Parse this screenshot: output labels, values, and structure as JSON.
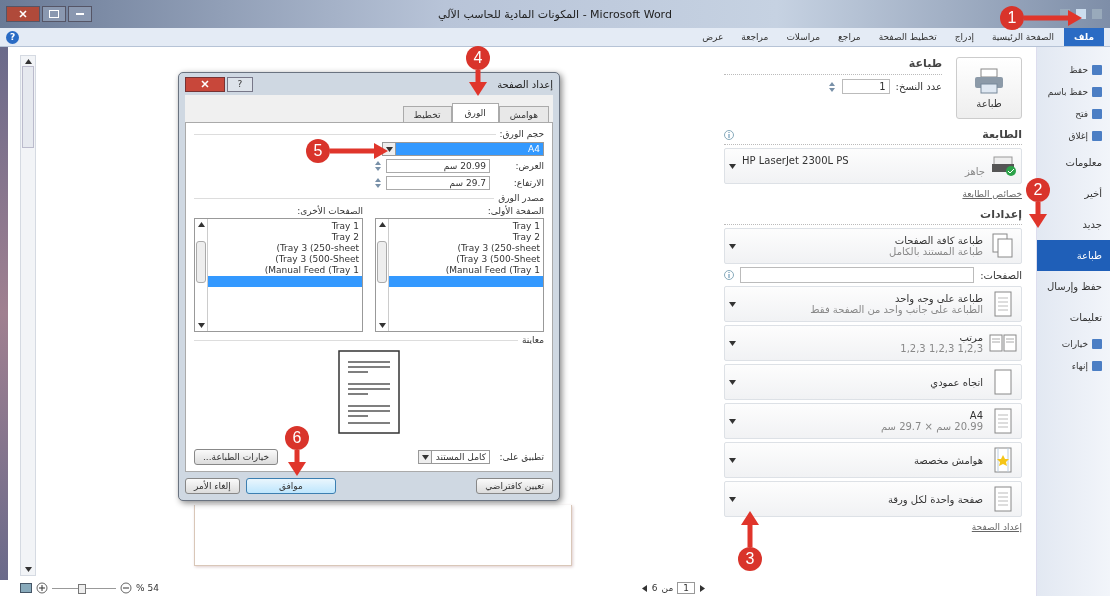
{
  "window": {
    "title": "المكونات المادية للحاسب الآلي - Microsoft Word"
  },
  "ribbon_tabs": [
    {
      "label": "ملف",
      "selected": true
    },
    {
      "label": "الصفحة الرئيسية",
      "selected": false
    },
    {
      "label": "إدراج",
      "selected": false
    },
    {
      "label": "تخطيط الصفحة",
      "selected": false
    },
    {
      "label": "مراجع",
      "selected": false
    },
    {
      "label": "مراسلات",
      "selected": false
    },
    {
      "label": "مراجعة",
      "selected": false
    },
    {
      "label": "عرض",
      "selected": false
    }
  ],
  "backstage_nav": [
    {
      "label": "حفظ",
      "kind": "command",
      "selected": false
    },
    {
      "label": "حفظ باسم",
      "kind": "command",
      "selected": false
    },
    {
      "label": "فتح",
      "kind": "command",
      "selected": false
    },
    {
      "label": "إغلاق",
      "kind": "command",
      "selected": false
    },
    {
      "label": "معلومات",
      "kind": "page",
      "selected": false
    },
    {
      "label": "أخير",
      "kind": "page",
      "selected": false
    },
    {
      "label": "جديد",
      "kind": "page",
      "selected": false
    },
    {
      "label": "طباعة",
      "kind": "page",
      "selected": true
    },
    {
      "label": "حفظ وإرسال",
      "kind": "page",
      "selected": false
    },
    {
      "label": "تعليمات",
      "kind": "page",
      "selected": false
    },
    {
      "label": "خيارات",
      "kind": "command",
      "selected": false
    },
    {
      "label": "إنهاء",
      "kind": "command",
      "selected": false
    }
  ],
  "print": {
    "heading": "طباعة",
    "copies_label": "عدد النسخ:",
    "copies": "1",
    "button": "طباعة",
    "printer_heading": "الطابعة",
    "printer_name": "HP LaserJet 2300L PS",
    "printer_status": "جاهز",
    "printer_properties": "خصائص الطابعة",
    "settings_heading": "إعدادات",
    "settings": [
      {
        "kind": "pages",
        "title": "طباعة كافة الصفحات",
        "subtitle": "طباعة المستند بالكامل"
      },
      {
        "kind": "field",
        "title": "الصفحات:"
      },
      {
        "kind": "sides",
        "title": "طباعة على وجه واحد",
        "subtitle": "الطباعة على جانب واحد من الصفحة فقط"
      },
      {
        "kind": "collate",
        "title": "مرتب",
        "subtitle": "1,2,3   1,2,3   1,2,3"
      },
      {
        "kind": "orientation",
        "title": "اتجاه عمودي"
      },
      {
        "kind": "size",
        "title": "A4",
        "subtitle": "20.99 سم × 29.7 سم"
      },
      {
        "kind": "margins",
        "title": "هوامش مخصصة"
      },
      {
        "kind": "per_sheet",
        "title": "صفحة واحدة لكل ورقة"
      }
    ],
    "page_setup_link": "إعداد الصفحة"
  },
  "dialog": {
    "title": "إعداد الصفحة",
    "help_button": "?",
    "tabs": [
      {
        "label": "هوامش",
        "selected": false
      },
      {
        "label": "الورق",
        "selected": true
      },
      {
        "label": "تخطيط",
        "selected": false
      }
    ],
    "paper_size_label": "حجم الورق:",
    "paper_size": "A4",
    "width_label": "العرض:",
    "width": "20.99 سم",
    "height_label": "الارتفاع:",
    "height": "29.7 سم",
    "paper_source_label": "مصدر الورق",
    "source_lists": [
      {
        "label": "الصفحة الأولى:",
        "items": [
          {
            "label": "Tray 1",
            "selected": false
          },
          {
            "label": "Tray 2",
            "selected": false
          },
          {
            "label": "(Tray 3 (250-sheet",
            "selected": false
          },
          {
            "label": "(Tray 3 (500-Sheet",
            "selected": false
          },
          {
            "label": "(Manual Feed (Tray 1",
            "selected": false
          },
          {
            "selected": true
          }
        ]
      },
      {
        "label": "الصفحات الأخرى:",
        "items": [
          {
            "label": "Tray 1",
            "selected": false
          },
          {
            "label": "Tray 2",
            "selected": false
          },
          {
            "label": "(Tray 3 (250-sheet",
            "selected": false
          },
          {
            "label": "(Tray 3 (500-Sheet",
            "selected": false
          },
          {
            "label": "(Manual Feed (Tray 1",
            "selected": false
          },
          {
            "selected": true
          }
        ]
      }
    ],
    "preview_label": "معاينة",
    "apply_label": "تطبيق على:",
    "apply_value": "كامل المستند",
    "print_options": "خيارات الطباعة...",
    "buttons": [
      {
        "label": "تعيين كافتراضي"
      },
      {
        "label": "موافق"
      },
      {
        "label": "إلغاء الأمر"
      }
    ]
  },
  "help_icon": "?",
  "status_bar": {
    "zoom_slider": {
      "level": 0.45
    },
    "zoom": "% 54",
    "page_current": "1",
    "page_of": "من",
    "page_total": "6"
  },
  "annotations": [
    "1",
    "2",
    "3",
    "4",
    "5",
    "6"
  ]
}
